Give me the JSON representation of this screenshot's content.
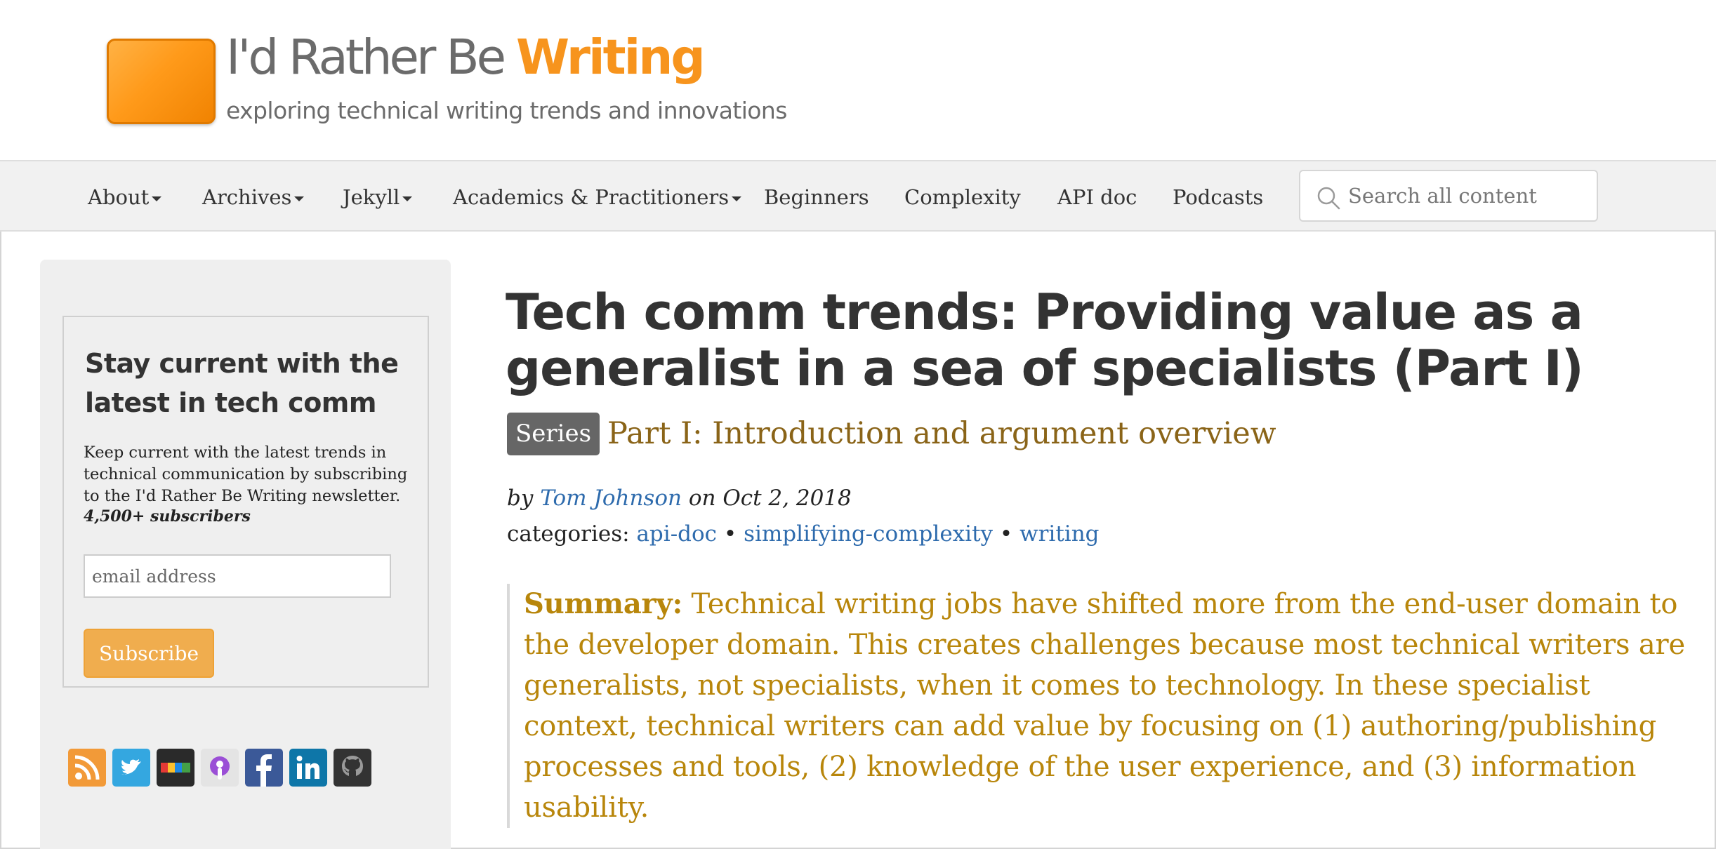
{
  "site": {
    "logo_text": "I'd Rather Be",
    "logo_accent": "Writing",
    "tagline": "exploring technical writing trends and innovations"
  },
  "nav": {
    "items": [
      {
        "label": "About",
        "dropdown": true
      },
      {
        "label": "Archives",
        "dropdown": true
      },
      {
        "label": "Jekyll",
        "dropdown": true
      },
      {
        "label": "Academics & Practitioners",
        "dropdown": true
      },
      {
        "label": "Beginners",
        "dropdown": false
      },
      {
        "label": "Complexity",
        "dropdown": false
      },
      {
        "label": "API doc",
        "dropdown": false
      },
      {
        "label": "Podcasts",
        "dropdown": false
      }
    ],
    "search_placeholder": "Search all content"
  },
  "sidebar": {
    "newsletter_title": "Stay current with the latest in tech comm",
    "newsletter_text": "Keep current with the latest trends in technical communication by subscribing to the I'd Rather Be Writing newsletter.",
    "subscribers": "4,500+ subscribers",
    "email_placeholder": "email address",
    "subscribe_label": "Subscribe",
    "social_icons": [
      "rss-icon",
      "twitter-icon",
      "instagram-icon",
      "podcast-icon",
      "facebook-icon",
      "linkedin-icon",
      "github-icon"
    ]
  },
  "article": {
    "title": "Tech comm trends: Providing value as a generalist in a sea of specialists (Part I)",
    "series_label": "Series",
    "series_title": "Part I: Introduction and argument overview",
    "by": "by",
    "author": "Tom Johnson",
    "date_prefix": "on",
    "date": "Oct 2, 2018",
    "categories_label": "categories:",
    "categories": [
      "api-doc",
      "simplifying-complexity",
      "writing"
    ],
    "category_separator": "•",
    "summary_label": "Summary:",
    "summary": "Technical writing jobs have shifted more from the end-user domain to the developer domain. This creates challenges because most technical writers are generalists, not specialists, when it comes to technology. In these specialist context, technical writers can add value by focusing on (1) authoring/publishing processes and tools, (2) knowledge of the user experience, and (3) information usability."
  },
  "colors": {
    "logo_orange": "#f7941d",
    "nav_bg": "#f1f1f1",
    "sidebar_bg": "#efefef",
    "subscribe_bg": "#f0ad4e",
    "series_badge": "#666666",
    "series_title": "#8a6418",
    "link": "#2e6bad",
    "summary": "#b8860b"
  }
}
